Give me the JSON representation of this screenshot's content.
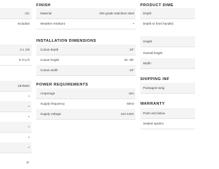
{
  "left_column": {
    "rows": [
      {
        "value": "UC"
      },
      {
        "value": "Included"
      },
      {
        "value": ""
      },
      {
        "value": "2 x 1/8"
      },
      {
        "value": "5.7cu ft"
      },
      {
        "value": ""
      },
      {
        "value": "267kWh"
      },
      {
        "value": "•"
      },
      {
        "value": "•"
      },
      {
        "value": "•"
      },
      {
        "value": "•"
      },
      {
        "value": "•"
      },
      {
        "value": "•"
      },
      {
        "value": "6\""
      }
    ]
  },
  "finish": {
    "title": "FINISH",
    "rows": [
      {
        "label": "Material",
        "value": "304 grade stainless steel"
      },
      {
        "label": "Weather resistant",
        "value": "•"
      }
    ]
  },
  "installation": {
    "title": "INSTALLATION DIMENSIONS",
    "rows": [
      {
        "label": "Cutout depth",
        "value": "24\""
      },
      {
        "label": "Cutout height",
        "value": "34 -35\""
      },
      {
        "label": "Cutout width",
        "value": "24\""
      }
    ]
  },
  "power": {
    "title": "POWER REQUIREMENTS",
    "rows": [
      {
        "label": "Amperage",
        "value": "15A"
      },
      {
        "label": "Supply frequency",
        "value": "60Hz"
      },
      {
        "label": "Supply voltage",
        "value": "110-120V"
      }
    ]
  },
  "product_dimensions": {
    "title": "PRODUCT DIME",
    "rows": [
      {
        "label": "Depth"
      },
      {
        "label": "Depth to front handle)"
      },
      {
        "label": "Height"
      },
      {
        "label": "Overall height"
      },
      {
        "label": "Width"
      }
    ]
  },
  "shipping": {
    "title": "SHIPPING INF",
    "rows": [
      {
        "label": "Packaged weig"
      }
    ]
  },
  "warranty": {
    "title": "WARRANTY",
    "rows": [
      {
        "label": "Parts and labou"
      },
      {
        "label": "Sealed system"
      }
    ]
  }
}
